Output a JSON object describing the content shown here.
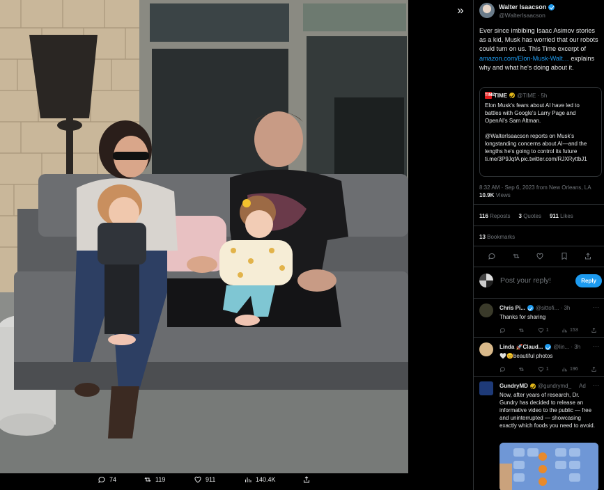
{
  "media": {
    "expand_icon": "»",
    "actions": [
      {
        "icon": "reply-icon",
        "value": "74"
      },
      {
        "icon": "repost-icon",
        "value": "119"
      },
      {
        "icon": "like-icon",
        "value": "911"
      },
      {
        "icon": "views-icon",
        "value": "140.4K"
      },
      {
        "icon": "share-icon",
        "value": ""
      }
    ]
  },
  "tweet": {
    "author_name": "Walter Isaacson",
    "author_handle": "@WalterIsaacson",
    "text_1": "Ever since imbibing Isaac Asimov stories as a kid, Musk has worried that our robots could turn on us.  This Time excerpt of ",
    "link": "amazon.com/Elon-Musk-Walt…",
    "text_2": " explains why and what he's doing about it.",
    "quote": {
      "logo": "TIME",
      "name": "TIME",
      "meta": "@TIME · 5h",
      "p1": "Elon Musk's fears about AI have led to battles with Google's Larry Page and OpenAI's Sam Altman.",
      "p2": "@WalterIsaacson reports on Musk's longstanding concerns about AI—and the lengths he's going to control its future ti.me/3P9JqfA pic.twitter.com/RJXRyttbJ1"
    },
    "timestamp": "8:32 AM · Sep 6, 2023 from New Orleans, LA",
    "views_count": "10.9K",
    "views_label": "Views",
    "reposts_count": "116",
    "reposts_label": "Reposts",
    "quotes_count": "3",
    "quotes_label": "Quotes",
    "likes_count": "911",
    "likes_label": "Likes",
    "bookmarks_count": "13",
    "bookmarks_label": "Bookmarks"
  },
  "reply_box": {
    "placeholder": "Post your reply!",
    "button": "Reply"
  },
  "replies": [
    {
      "name": "Chris Pi...",
      "meta": "@sittofi... · 3h",
      "text": "Thanks for sharing",
      "likes": "1",
      "views": "153",
      "avatar_color": "#3a3a2a"
    },
    {
      "name": "Linda 🚀Claud...",
      "meta": "@lin... · 3h",
      "text": "🤍😊beautiful photos",
      "likes": "1",
      "views": "196",
      "avatar_color": "#d9b98a"
    },
    {
      "name": "GundryMD",
      "meta": "@gundrymd_",
      "ad_label": "Ad",
      "text": "Now, after years of research, Dr. Gundry has decided to release an informative video to the public — free and uninterrupted — showcasing exactly which foods you need to avoid.",
      "avatar_color": "#1e3a78"
    }
  ],
  "colors": {
    "accent": "#1d9bf0",
    "background": "#000000",
    "muted": "#71767b",
    "border": "#2f3336"
  }
}
